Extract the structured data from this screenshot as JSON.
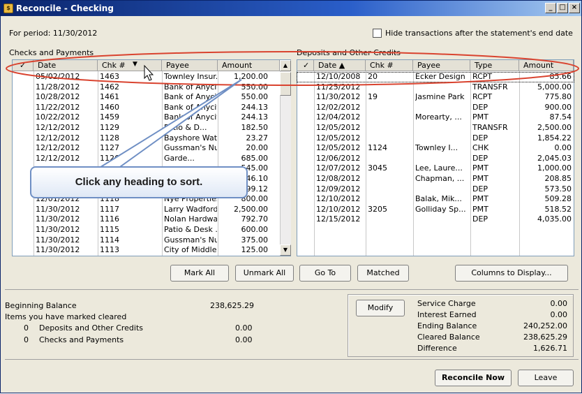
{
  "window": {
    "title": "Reconcile - Checking",
    "icon_text": "$"
  },
  "period_label": "For period: 11/30/2012",
  "hide_checkbox_label": "Hide transactions after the statement's end date",
  "checks": {
    "section_title": "Checks and Payments",
    "columns": [
      "✓",
      "Date",
      "Chk #",
      "Payee",
      "Amount"
    ],
    "rows": [
      {
        "date": "05/02/2012",
        "chk": "1463",
        "payee": "Townley Insur...",
        "amount": "1,200.00"
      },
      {
        "date": "11/28/2012",
        "chk": "1462",
        "payee": "Bank of Anycity",
        "amount": "550.00"
      },
      {
        "date": "10/28/2012",
        "chk": "1461",
        "payee": "Bank of Anycity",
        "amount": "550.00"
      },
      {
        "date": "11/22/2012",
        "chk": "1460",
        "payee": "Bank of Anycity",
        "amount": "244.13"
      },
      {
        "date": "10/22/2012",
        "chk": "1459",
        "payee": "Bank of Anycity",
        "amount": "244.13"
      },
      {
        "date": "12/12/2012",
        "chk": "1129",
        "payee": "Patio & D...",
        "amount": "182.50"
      },
      {
        "date": "12/12/2012",
        "chk": "1128",
        "payee": "Bayshore Water",
        "amount": "23.27"
      },
      {
        "date": "12/12/2012",
        "chk": "1127",
        "payee": "Gussman's Nu...",
        "amount": "20.00"
      },
      {
        "date": "12/12/2012",
        "chk": "1126",
        "payee": "Garde...",
        "amount": "685.00"
      },
      {
        "date": "",
        "chk": "",
        "payee": "",
        "amount": "545.00"
      },
      {
        "date": "",
        "chk": "",
        "payee": "",
        "amount": "446.10"
      },
      {
        "date": "",
        "chk": "",
        "payee": "",
        "amount": "699.12"
      },
      {
        "date": "12/01/2012",
        "chk": "1118",
        "payee": "Nye Properties",
        "amount": "800.00"
      },
      {
        "date": "11/30/2012",
        "chk": "1117",
        "payee": "Larry Wadford",
        "amount": "2,500.00"
      },
      {
        "date": "11/30/2012",
        "chk": "1116",
        "payee": "Nolan Hardwa...",
        "amount": "792.70"
      },
      {
        "date": "11/30/2012",
        "chk": "1115",
        "payee": "Patio & Desk ...",
        "amount": "600.00"
      },
      {
        "date": "11/30/2012",
        "chk": "1114",
        "payee": "Gussman's Nu...",
        "amount": "375.00"
      },
      {
        "date": "11/30/2012",
        "chk": "1113",
        "payee": "City of Middle...",
        "amount": "125.00"
      }
    ]
  },
  "deposits": {
    "section_title": "Deposits and Other Credits",
    "columns": [
      "✓",
      "Date ▲",
      "Chk #",
      "Payee",
      "Type",
      "Amount"
    ],
    "rows": [
      {
        "date": "12/10/2008",
        "chk": "20",
        "payee": "Ecker Design",
        "type": "RCPT",
        "amount": "85.66"
      },
      {
        "date": "11/25/2012",
        "chk": "",
        "payee": "",
        "type": "TRANSFR",
        "amount": "5,000.00"
      },
      {
        "date": "11/30/2012",
        "chk": "19",
        "payee": "Jasmine Park",
        "type": "RCPT",
        "amount": "775.80"
      },
      {
        "date": "12/02/2012",
        "chk": "",
        "payee": "",
        "type": "DEP",
        "amount": "900.00"
      },
      {
        "date": "12/04/2012",
        "chk": "",
        "payee": "Morearty, ...",
        "type": "PMT",
        "amount": "87.54"
      },
      {
        "date": "12/05/2012",
        "chk": "",
        "payee": "",
        "type": "TRANSFR",
        "amount": "2,500.00"
      },
      {
        "date": "12/05/2012",
        "chk": "",
        "payee": "",
        "type": "DEP",
        "amount": "1,854.22"
      },
      {
        "date": "12/05/2012",
        "chk": "1124",
        "payee": "Townley I...",
        "type": "CHK",
        "amount": "0.00"
      },
      {
        "date": "12/06/2012",
        "chk": "",
        "payee": "",
        "type": "DEP",
        "amount": "2,045.03"
      },
      {
        "date": "12/07/2012",
        "chk": "3045",
        "payee": "Lee, Laure...",
        "type": "PMT",
        "amount": "1,000.00"
      },
      {
        "date": "12/08/2012",
        "chk": "",
        "payee": "Chapman, ...",
        "type": "PMT",
        "amount": "208.85"
      },
      {
        "date": "12/09/2012",
        "chk": "",
        "payee": "",
        "type": "DEP",
        "amount": "573.50"
      },
      {
        "date": "12/10/2012",
        "chk": "",
        "payee": "Balak, Mik...",
        "type": "PMT",
        "amount": "509.28"
      },
      {
        "date": "12/10/2012",
        "chk": "3205",
        "payee": "Golliday Sp...",
        "type": "PMT",
        "amount": "518.52"
      },
      {
        "date": "12/15/2012",
        "chk": "",
        "payee": "",
        "type": "DEP",
        "amount": "4,035.00"
      }
    ]
  },
  "chk_sort_arrow": "▼",
  "scroll": {
    "up": "▲",
    "down": "▼"
  },
  "buttons": {
    "mark_all": "Mark All",
    "unmark_all": "Unmark All",
    "go_to": "Go To",
    "matched": "Matched",
    "columns_to_display": "Columns to Display...",
    "modify": "Modify",
    "reconcile_now": "Reconcile Now",
    "leave": "Leave"
  },
  "summary": {
    "beginning_balance_label": "Beginning Balance",
    "beginning_balance_value": "238,625.29",
    "items_marked_label": "Items you have marked cleared",
    "deposits_count": "0",
    "deposits_label": "Deposits and Other Credits",
    "deposits_value": "0.00",
    "checks_count": "0",
    "checks_label": "Checks and Payments",
    "checks_value": "0.00"
  },
  "totals": [
    {
      "label": "Service Charge",
      "value": "0.00"
    },
    {
      "label": "Interest Earned",
      "value": "0.00"
    },
    {
      "label": "Ending Balance",
      "value": "240,252.00"
    },
    {
      "label": "Cleared Balance",
      "value": "238,625.29"
    },
    {
      "label": "Difference",
      "value": "1,626.71"
    }
  ],
  "callout_text": "Click any heading to sort.",
  "highlight_color": "#d9432f",
  "window_controls": {
    "minimize": "_",
    "maximize": "□",
    "close": "×"
  }
}
